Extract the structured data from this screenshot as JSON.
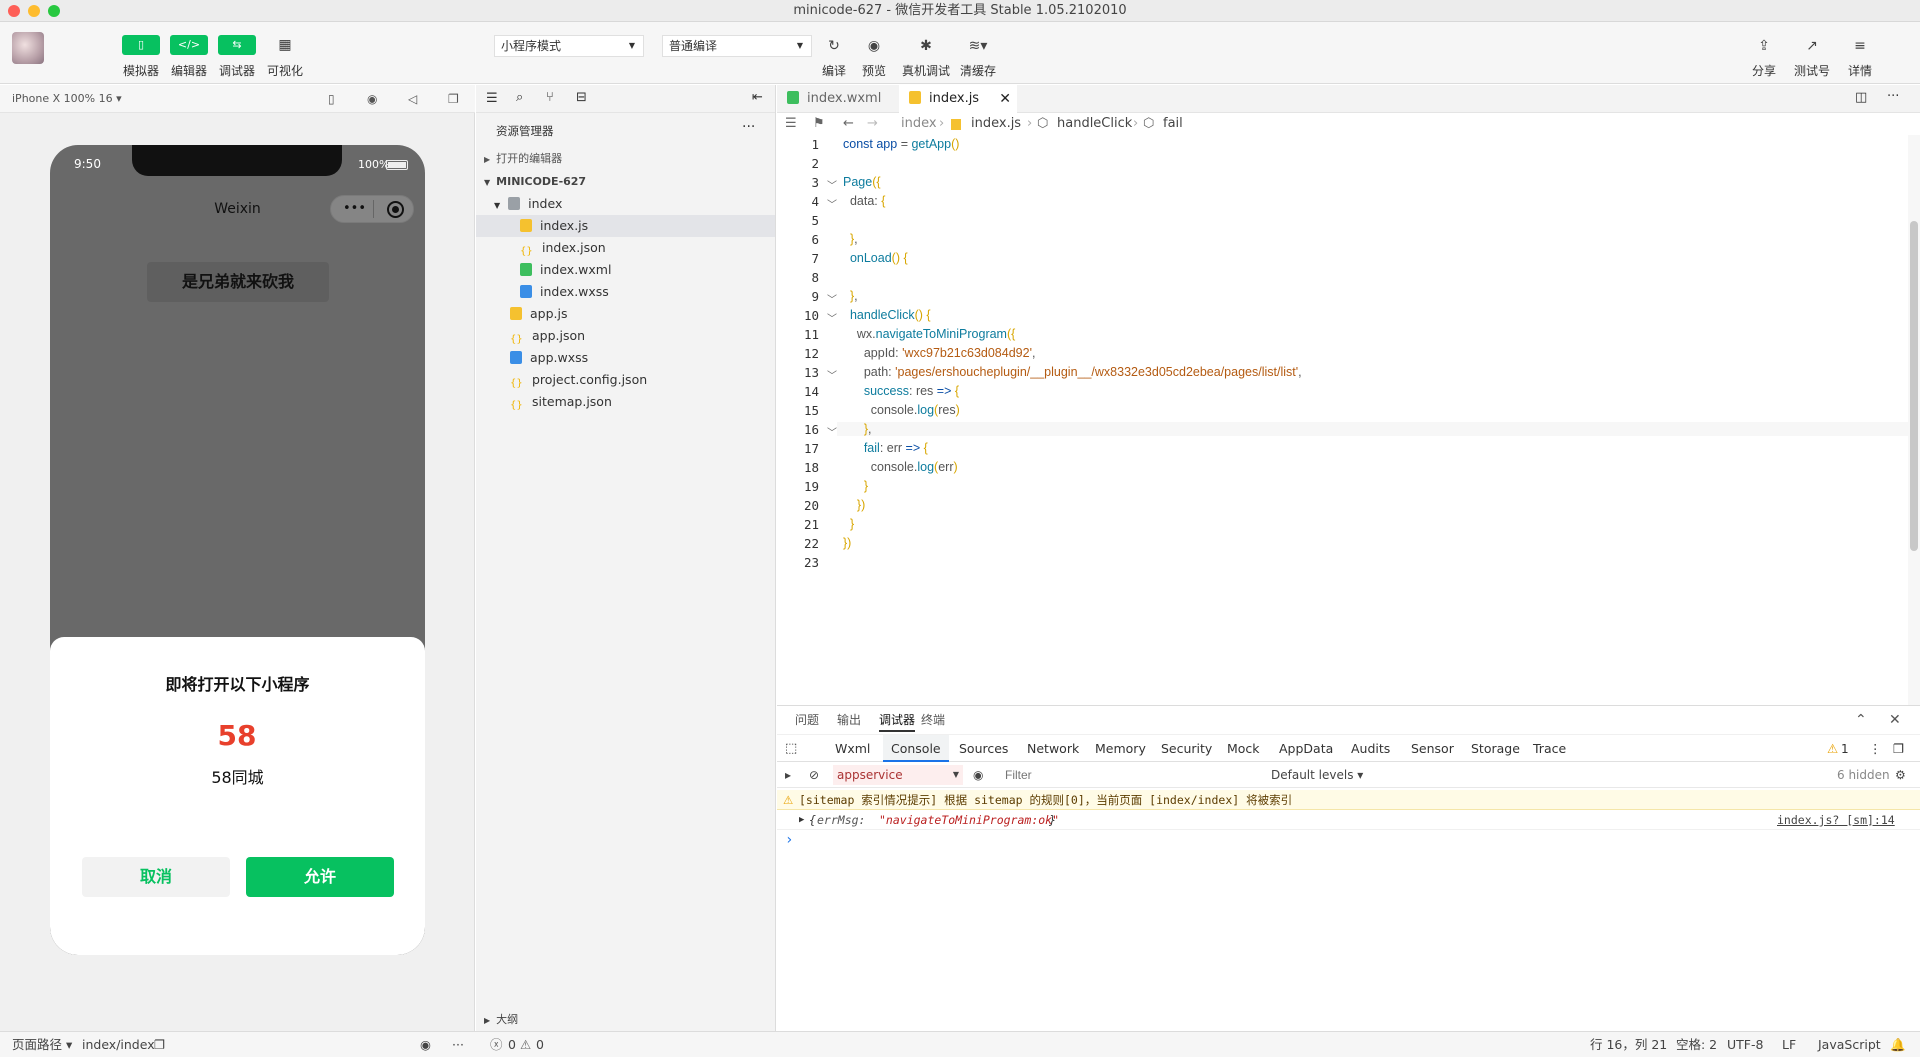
{
  "window": {
    "title": "minicode-627 - 微信开发者工具 Stable 1.05.2102010"
  },
  "toolbar": {
    "left_buttons": [
      {
        "label": "模拟器",
        "icon": "phone-icon"
      },
      {
        "label": "编辑器",
        "icon": "code-icon"
      },
      {
        "label": "调试器",
        "icon": "debug-icon"
      },
      {
        "label": "可视化",
        "icon": "layout-icon"
      }
    ],
    "mode_select": "小程序模式",
    "compile_select": "普通编译",
    "center_buttons": [
      {
        "label": "编译",
        "icon": "refresh-icon"
      },
      {
        "label": "预览",
        "icon": "eye-icon"
      },
      {
        "label": "真机调试",
        "icon": "bug-icon"
      },
      {
        "label": "清缓存",
        "icon": "layers-icon"
      }
    ],
    "right_buttons": [
      {
        "label": "分享",
        "icon": "upload-icon"
      },
      {
        "label": "测试号",
        "icon": "external-icon"
      },
      {
        "label": "详情",
        "icon": "menu-icon"
      }
    ]
  },
  "simulator": {
    "device": "iPhone X 100% 16 ▾",
    "time": "9:50",
    "battery": "100%",
    "nav_title": "Weixin",
    "page_button": "是兄弟就来砍我",
    "dialog": {
      "title": "即将打开以下小程序",
      "logo_text": "58",
      "app_name": "58同城",
      "cancel": "取消",
      "allow": "允许"
    }
  },
  "explorer": {
    "title": "资源管理器",
    "more": "···",
    "open_editors": "打开的编辑器",
    "project": "MINICODE-627",
    "outline": "大纲",
    "files": [
      {
        "name": "index",
        "type": "folder",
        "depth": 1
      },
      {
        "name": "index.js",
        "type": "js",
        "depth": 2,
        "active": true
      },
      {
        "name": "index.json",
        "type": "json",
        "depth": 2
      },
      {
        "name": "index.wxml",
        "type": "wxml",
        "depth": 2
      },
      {
        "name": "index.wxss",
        "type": "wxss",
        "depth": 2
      },
      {
        "name": "app.js",
        "type": "js",
        "depth": 1
      },
      {
        "name": "app.json",
        "type": "json",
        "depth": 1
      },
      {
        "name": "app.wxss",
        "type": "wxss",
        "depth": 1
      },
      {
        "name": "project.config.json",
        "type": "json",
        "depth": 1
      },
      {
        "name": "sitemap.json",
        "type": "json",
        "depth": 1
      }
    ]
  },
  "editor": {
    "tabs": [
      {
        "label": "index.wxml",
        "active": false
      },
      {
        "label": "index.js",
        "active": true
      }
    ],
    "breadcrumb": [
      "index",
      "index.js",
      "handleClick",
      "fail"
    ],
    "code_lines": [
      [
        [
          "kw",
          "const "
        ],
        [
          "kw",
          "app"
        ],
        [
          "pu",
          " = "
        ],
        [
          "fn",
          "getApp"
        ],
        [
          "br",
          "()"
        ]
      ],
      [],
      [
        [
          "fn",
          "Page"
        ],
        [
          "br",
          "({"
        ]
      ],
      [
        [
          "pu",
          "  data: "
        ],
        [
          "br",
          "{"
        ]
      ],
      [],
      [
        [
          "br",
          "  }"
        ],
        [
          "pu",
          ","
        ]
      ],
      [
        [
          "fn",
          "  onLoad"
        ],
        [
          "br",
          "() {"
        ]
      ],
      [],
      [
        [
          "br",
          "  }"
        ],
        [
          "pu",
          ","
        ]
      ],
      [
        [
          "fn",
          "  handleClick"
        ],
        [
          "br",
          "() {"
        ]
      ],
      [
        [
          "pu",
          "    wx."
        ],
        [
          "fn",
          "navigateToMiniProgram"
        ],
        [
          "br",
          "({"
        ]
      ],
      [
        [
          "pu",
          "      appId: "
        ],
        [
          "str",
          "'wxc97b21c63d084d92'"
        ],
        [
          "pu",
          ","
        ]
      ],
      [
        [
          "pu",
          "      path: "
        ],
        [
          "str",
          "'pages/ershoucheplugin/__plugin__/wx8332e3d05cd2ebea/pages/list/list'"
        ],
        [
          "pu",
          ","
        ]
      ],
      [
        [
          "fn",
          "      success"
        ],
        [
          "pu",
          ": res "
        ],
        [
          "kw",
          "=>"
        ],
        [
          "br",
          " {"
        ]
      ],
      [
        [
          "pu",
          "        console."
        ],
        [
          "fn",
          "log"
        ],
        [
          "br",
          "("
        ],
        [
          "pu",
          "res"
        ],
        [
          "br",
          ")"
        ]
      ],
      [
        [
          "br",
          "      }"
        ],
        [
          "pu",
          ","
        ]
      ],
      [
        [
          "fn",
          "      fail"
        ],
        [
          "pu",
          ": err "
        ],
        [
          "kw",
          "=>"
        ],
        [
          "br",
          " {"
        ]
      ],
      [
        [
          "pu",
          "        console."
        ],
        [
          "fn",
          "log"
        ],
        [
          "br",
          "("
        ],
        [
          "pu",
          "err"
        ],
        [
          "br",
          ")"
        ]
      ],
      [
        [
          "br",
          "      }"
        ]
      ],
      [
        [
          "br",
          "    })"
        ]
      ],
      [
        [
          "br",
          "  }"
        ]
      ],
      [
        [
          "br",
          "})"
        ]
      ]
    ],
    "fold_lines": [
      3,
      4,
      9,
      10,
      13,
      16
    ]
  },
  "panel": {
    "top_tabs": [
      "问题",
      "输出",
      "调试器",
      "终端"
    ],
    "active_top_tab": "调试器",
    "dev_tabs": [
      "Wxml",
      "Console",
      "Sources",
      "Network",
      "Memory",
      "Security",
      "Mock",
      "AppData",
      "Audits",
      "Sensor",
      "Storage",
      "Trace"
    ],
    "active_dev_tab": "Console",
    "warning_count": "1",
    "context": "appservice",
    "filter_placeholder": "Filter",
    "levels": "Default levels ▾",
    "hidden": "6 hidden",
    "warning_msg": "[sitemap 索引情况提示] 根据 sitemap 的规则[0]，当前页面 [index/index] 将被索引",
    "log_msg_key": "errMsg:",
    "log_msg_val": "\"navigateToMiniProgram:ok\"",
    "log_source": "index.js? [sm]:14",
    "prompt": "›"
  },
  "status": {
    "page_path_label": "页面路径 ▾",
    "page_path": "index/index",
    "errors": "0",
    "warnings": "0",
    "cursor": "行 16，列 21",
    "spaces": "空格: 2",
    "encoding": "UTF-8",
    "eol": "LF",
    "language": "JavaScript"
  },
  "colors": {
    "accent": "#07c160",
    "warning_bg": "#fffbe6",
    "link": "#0a4ea5"
  }
}
